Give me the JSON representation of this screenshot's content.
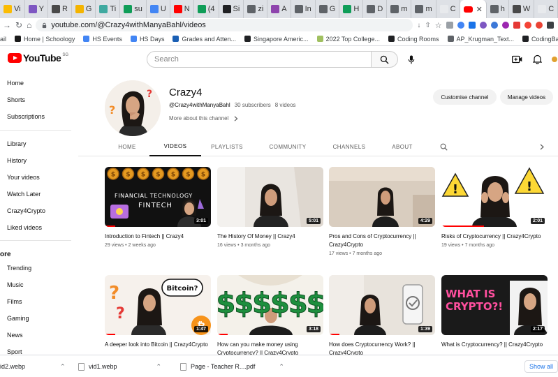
{
  "browser": {
    "tabs": [
      {
        "label": "Vi",
        "color": "#fbbc04"
      },
      {
        "label": "Y",
        "color": "#7e57c2"
      },
      {
        "label": "R",
        "color": "#4a4a4a"
      },
      {
        "label": "G",
        "color": "#f4b400"
      },
      {
        "label": "Ti",
        "color": "#3fa9a0"
      },
      {
        "label": "su",
        "color": "#0f9d58"
      },
      {
        "label": "U",
        "color": "#4285f4"
      },
      {
        "label": "N",
        "color": "#ff0000"
      },
      {
        "label": "(4",
        "color": "#0f9d58"
      },
      {
        "label": "Si",
        "color": "#202124"
      },
      {
        "label": "zi",
        "color": "#5f6368"
      },
      {
        "label": "A",
        "color": "#8e44ad"
      },
      {
        "label": "In",
        "color": "#5f6368"
      },
      {
        "label": "G",
        "color": "#5f6368"
      },
      {
        "label": "H",
        "color": "#0f9d58"
      },
      {
        "label": "D",
        "color": "#5f6368"
      },
      {
        "label": "m",
        "color": "#5f6368"
      },
      {
        "label": "m",
        "color": "#5f6368"
      },
      {
        "label": "C",
        "color": "#e8eaed"
      },
      {
        "label": "",
        "color": "#ff0000",
        "active": true
      },
      {
        "label": "h",
        "color": "#5f6368"
      },
      {
        "label": "W",
        "color": "#4a4a4a"
      },
      {
        "label": "C",
        "color": "#e8eaed"
      },
      {
        "label": "R",
        "color": "#4a4a4a"
      },
      {
        "label": "Ti",
        "color": "#3c78d8"
      },
      {
        "label": "B",
        "color": "#4a148c"
      }
    ],
    "url": "youtube.com/@Crazy4withManyaBahl/videos",
    "bookmarks": [
      {
        "label": "ail",
        "color": "#ffffff"
      },
      {
        "label": "Home | Schoology",
        "color": "#1a1a1a"
      },
      {
        "label": "HS Events",
        "color": "#4285f4"
      },
      {
        "label": "HS Days",
        "color": "#4285f4"
      },
      {
        "label": "Grades and Atten...",
        "color": "#1a5fb4"
      },
      {
        "label": "Singapore Americ...",
        "color": "#202124"
      },
      {
        "label": "2022 Top College...",
        "color": "#a0c060"
      },
      {
        "label": "Coding Rooms",
        "color": "#202124"
      },
      {
        "label": "AP_Krugman_Text...",
        "color": "#5f6368"
      },
      {
        "label": "CodingBat Java L...",
        "color": "#202124"
      }
    ]
  },
  "youtube": {
    "logo_text": "YouTube",
    "country_code": "SG",
    "search_placeholder": "Search",
    "sidebar": [
      "Home",
      "Shorts",
      "Subscriptions",
      "Library",
      "History",
      "Your videos",
      "Watch Later",
      "Crazy4Crypto",
      "Liked videos",
      "Trending",
      "Music",
      "Films",
      "Gaming",
      "News",
      "Sport"
    ],
    "sidebar_heading": "ore"
  },
  "channel": {
    "name": "Crazy4",
    "handle": "@Crazy4withManyaBahl",
    "subscribers": "30 subscribers",
    "videos_count": "8 videos",
    "more_about": "More about this channel",
    "customise_label": "Customise channel",
    "manage_label": "Manage videos",
    "tabs": [
      "HOME",
      "VIDEOS",
      "PLAYLISTS",
      "COMMUNITY",
      "CHANNELS",
      "ABOUT"
    ],
    "active_tab": "VIDEOS"
  },
  "videos": [
    {
      "title": "Introduction to Fintech || Crazy4",
      "meta": "29 views • 2 weeks ago",
      "duration": "3:01",
      "progress": 0.1
    },
    {
      "title": "The History Of Money || Crazy4",
      "meta": "16 views • 3 months ago",
      "duration": "5:01",
      "progress": 0.0
    },
    {
      "title": "Pros and Cons of Cryptocurrency || Crazy4Crypto",
      "meta": "17 views • 7 months ago",
      "duration": "4:29",
      "progress": 0.0
    },
    {
      "title": "Risks of Cryptocurrency || Crazy4Crypto",
      "meta": "19 views • 7 months ago",
      "duration": "2:01",
      "progress": 0.4
    },
    {
      "title": "A deeper look into Bitcoin || Crazy4Crypto",
      "meta": "",
      "duration": "1:47",
      "progress": 0.1
    },
    {
      "title": "How can you make money using Cryptocurrency? || Crazy4Crypto",
      "meta": "",
      "duration": "3:18",
      "progress": 0.1
    },
    {
      "title": "How does Cryptocurrency Work? || Crazy4Crypto",
      "meta": "",
      "duration": "1:39",
      "progress": 0.1
    },
    {
      "title": "What is Cryptocurrency? || Crazy4Crypto",
      "meta": "",
      "duration": "2:17",
      "progress": 0.0
    }
  ],
  "thumb_text": {
    "fintech_line1": "FINANCIAL TECHNOLOGY",
    "fintech_line2": "FINTECH",
    "bitcoin_bubble": "Bitcoin?",
    "what_is_1": "WHAT IS",
    "what_is_2": "CRYPTO?!",
    "dollar_signs": "$$$$$$"
  },
  "downloads": {
    "items": [
      "id2.webp",
      "vid1.webp",
      "Page - Teacher R....pdf"
    ],
    "show_all": "Show all"
  }
}
